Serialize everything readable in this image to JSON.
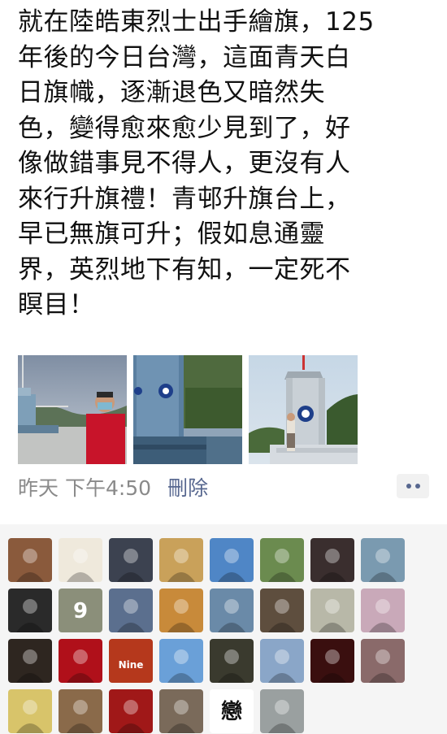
{
  "post": {
    "text_lines": [
      "就在陸皓東烈士出手繪旗，125",
      "年後的今日台灣，這面青天白",
      "日旗幟，逐漸退色又暗然失",
      "色，變得愈來愈少見到了，好",
      "像做錯事見不得人，更沒有人",
      "來行升旗禮！青邨升旗台上，",
      "早已無旗可升；假如息通靈",
      "界，英烈地下有知，一定死不",
      "瞑目！"
    ]
  },
  "photos": [
    {
      "subject": "man-in-red-jacket-at-flag-platform"
    },
    {
      "subject": "flag-platform-with-emblem"
    },
    {
      "subject": "man-standing-at-flag-monument"
    }
  ],
  "meta": {
    "time": "昨天 下午4:50",
    "delete_label": "刪除"
  },
  "likes": {
    "avatar_count": 30,
    "avatar_texts": {
      "9": "9",
      "18": "Nine",
      "28": "戀"
    },
    "avatar_colors": [
      "#8a5a3c",
      "#efe9dc",
      "#3c4250",
      "#c9a15a",
      "#4f86c6",
      "#6b8b4f",
      "#3a2e2e",
      "#7a9ab0",
      "#2a2a2a",
      "#8b8f7a",
      "#5b6f8e",
      "#c88a3a",
      "#6a8aa8",
      "#5e4e3e",
      "#b8b8a8",
      "#c9a9b9",
      "#2e2620",
      "#b0101a",
      "#b5381c",
      "#6aa0d8",
      "#3a3a2e",
      "#8aa6c8",
      "#3a0f0f",
      "#8a6a6a",
      "#d8c46a",
      "#8a6a4a",
      "#a01818",
      "#7a6a5a",
      "#ffffff",
      "#9aa0a0"
    ]
  }
}
